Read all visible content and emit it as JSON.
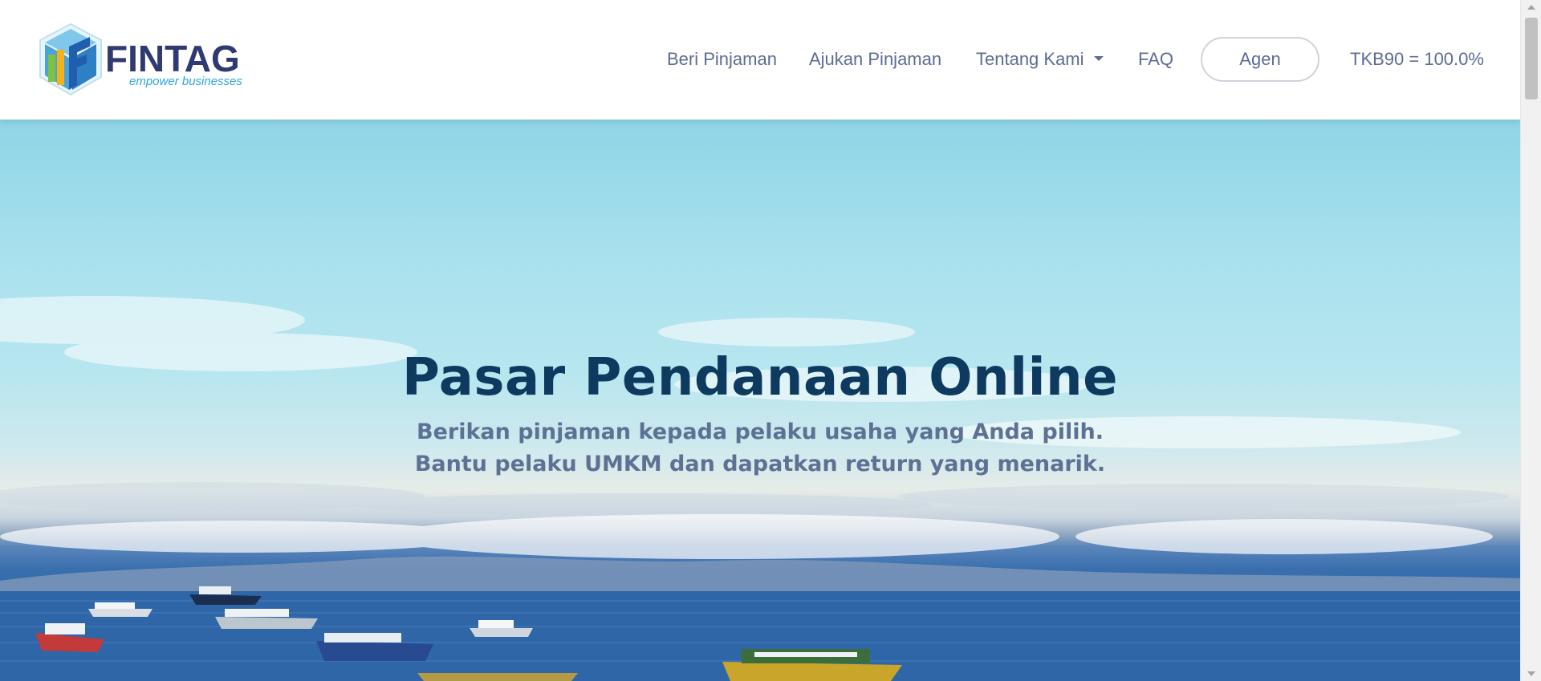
{
  "brand": {
    "name": "FINTAG",
    "tagline": "empower businesses"
  },
  "nav": {
    "items": [
      {
        "label": "Beri Pinjaman"
      },
      {
        "label": "Ajukan Pinjaman"
      },
      {
        "label": "Tentang Kami"
      },
      {
        "label": "FAQ"
      }
    ],
    "agen_label": "Agen",
    "tkb_label": "TKB90 = 100.0%"
  },
  "hero": {
    "title": "Pasar Pendanaan Online",
    "subtitle": "Berikan pinjaman kepada pelaku usaha yang Anda pilih. Bantu pelaku UMKM dan dapatkan return yang menarik."
  },
  "colors": {
    "nav_text": "#5d6c93",
    "hero_title": "#0d3a5e",
    "hero_subtitle": "#5d7194",
    "brand_dark": "#2e3a70",
    "brand_light": "#2aa6e0"
  },
  "icons": {
    "logo": "fintag-cube-logo-icon",
    "dropdown": "caret-down-icon"
  }
}
